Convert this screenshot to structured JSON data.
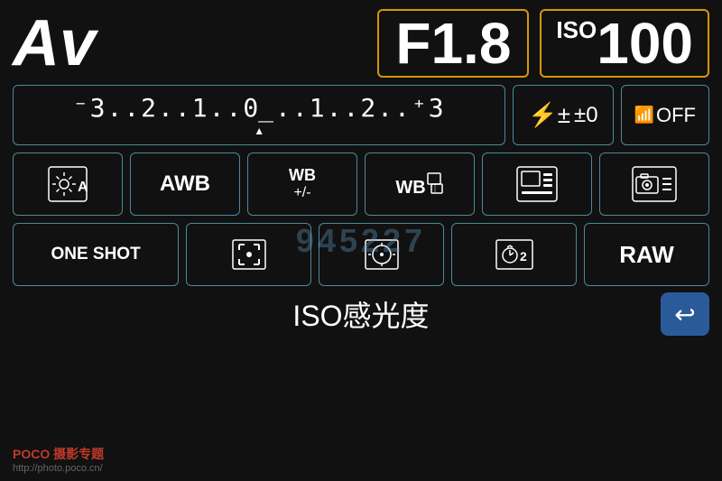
{
  "header": {
    "mode": "Av",
    "aperture": "F1.8",
    "iso_label": "ISO",
    "iso_value": "100"
  },
  "ev_scale": {
    "display": "⁻3..2..1..0..1..2..⁺3",
    "indicator": "▲"
  },
  "flash": {
    "label": "±0"
  },
  "wifi": {
    "label": "OFF"
  },
  "metering": {
    "label": "⊙A"
  },
  "awb": {
    "label": "AWB"
  },
  "wb_adjust": {
    "top": "WB",
    "bottom": "+/-"
  },
  "wb2": {
    "label": "WB"
  },
  "display_style": {},
  "camera_menu": {},
  "drive": {
    "label": "ONE SHOT"
  },
  "af_point": {},
  "af_mode": {},
  "timer": {
    "label": "2"
  },
  "image_format": {
    "label": "RAW"
  },
  "bottom_label": "ISO感光度",
  "back_button": "↩",
  "watermark": {
    "brand": "POCO",
    "subtitle": "摄影专题",
    "url": "http://photo.poco.cn/"
  },
  "center_watermark": "945227"
}
